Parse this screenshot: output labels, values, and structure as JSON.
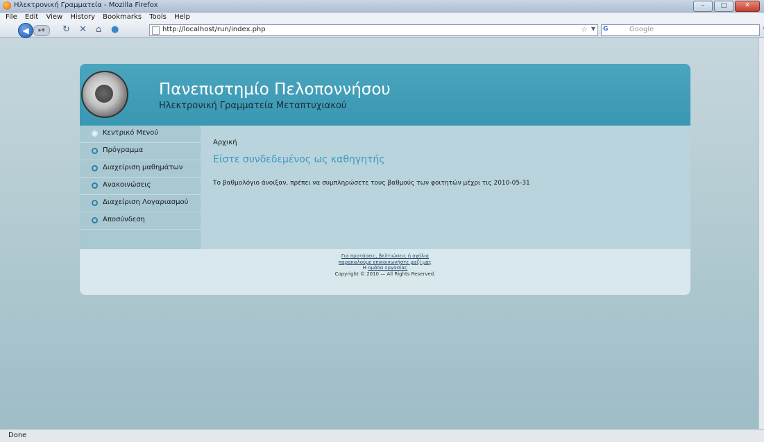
{
  "window": {
    "title": "Ηλεκτρονική Γραμματεία - Mozilla Firefox",
    "controls": [
      "–",
      "□",
      "✕"
    ]
  },
  "menubar": [
    "File",
    "Edit",
    "View",
    "History",
    "Bookmarks",
    "Tools",
    "Help"
  ],
  "toolbar": {
    "url": "http://localhost/run/index.php",
    "search_placeholder": "Google",
    "search_engine": "G",
    "back_icon": "back-arrow-icon",
    "home_glyph": "⌂"
  },
  "site": {
    "name": "Πανεπιστημίο Πελοποννήσου",
    "subtitle": "Ηλεκτρονική Γραμματεία Μεταπτυχιακού"
  },
  "sidebar": {
    "items": [
      {
        "label": "Κεντρικό Μενού",
        "active": true
      },
      {
        "label": "Πρόγραμμα",
        "active": false
      },
      {
        "label": "Διαχείριση μαθημάτων",
        "active": false
      },
      {
        "label": "Ανακοινώσεις",
        "active": false
      },
      {
        "label": "Διαχείριση Λογαριασμού",
        "active": false
      },
      {
        "label": "Αποσύνδεση",
        "active": false
      }
    ]
  },
  "main": {
    "breadcrumb": "Αρχική",
    "status": "Είστε συνδεδεμένος ως καθηγητής",
    "info": "Το βαθμολόγιο άνοιξαν, πρέπει να συμπληρώσετε τους βαθμούς των φοιτητών μέχρι τις 2010-05-31"
  },
  "footer": {
    "line1": "Για προτάσεις, βελτιώσεις ή σχόλια",
    "line2": "παρακαλούμε επικοινωνήστε μαζί μας",
    "line3_prefix": "Η ",
    "line3_link": "ομάδα εργασίας",
    "line4": "Copyright © 2010 — All Rights Reserved."
  },
  "statusbar": {
    "text": "Done"
  },
  "colors": {
    "header": "#4aa5be",
    "sidebar": "#a8c8d2",
    "content": "#b9d4dc",
    "footer": "#d8e8ec",
    "accent_text": "#3b9ac0"
  }
}
